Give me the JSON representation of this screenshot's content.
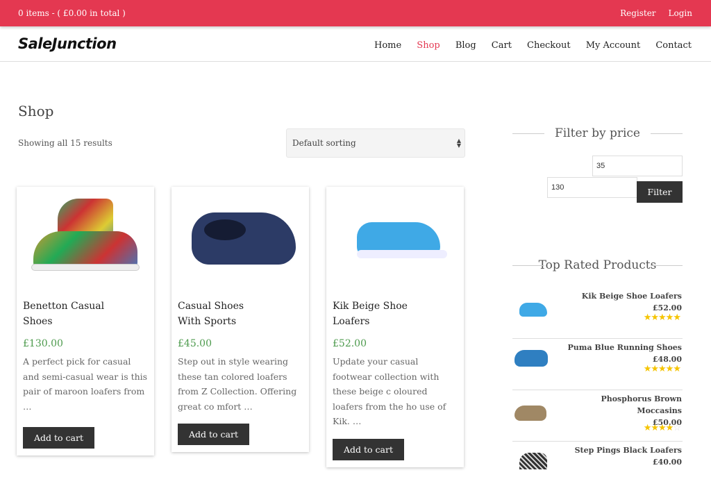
{
  "topbar": {
    "cart_summary": "0 items - ( £0.00 in total )",
    "register": "Register",
    "login": "Login"
  },
  "header": {
    "logo": "SaleJunction",
    "nav": [
      "Home",
      "Shop",
      "Blog",
      "Cart",
      "Checkout",
      "My Account",
      "Contact"
    ],
    "active": "Shop"
  },
  "colors": {
    "accent": "#e43851",
    "price": "#4c9a4c",
    "star": "#f5c400"
  },
  "main": {
    "title": "Shop",
    "result_count": "Showing all 15 results",
    "sorting": "Default sorting",
    "products": [
      {
        "title": "Benetton Casual Shoes",
        "price": "£130.00",
        "desc": "A perfect pick for casual and semi-casual wear is this pair of maroon loafers from …",
        "button": "Add to cart"
      },
      {
        "title": "Casual Shoes With Sports",
        "price": "£45.00",
        "desc": "Step out in style wearing these tan colored loafers from Z Collection. Offering great co mfort …",
        "button": "Add to cart"
      },
      {
        "title": "Kik Beige Shoe Loafers",
        "price": "£52.00",
        "desc": "Update your casual footwear collection with these beige c oloured loafers from the ho use of Kik. …",
        "button": "Add to cart"
      }
    ]
  },
  "sidebar": {
    "filter_title": "Filter by price",
    "min_price": "35",
    "max_price": "130",
    "filter_button": "Filter",
    "top_rated_title": "Top Rated Products",
    "top_rated": [
      {
        "name": "Kik Beige Shoe Loafers",
        "price": "£52.00",
        "rating": 5
      },
      {
        "name": "Puma Blue Running Shoes",
        "price": "£48.00",
        "rating": 5
      },
      {
        "name": "Phosphorus Brown Moccasins",
        "price": "£50.00",
        "rating": 4
      },
      {
        "name": "Step Pings Black Loafers",
        "price": "£40.00",
        "rating": null
      }
    ]
  }
}
